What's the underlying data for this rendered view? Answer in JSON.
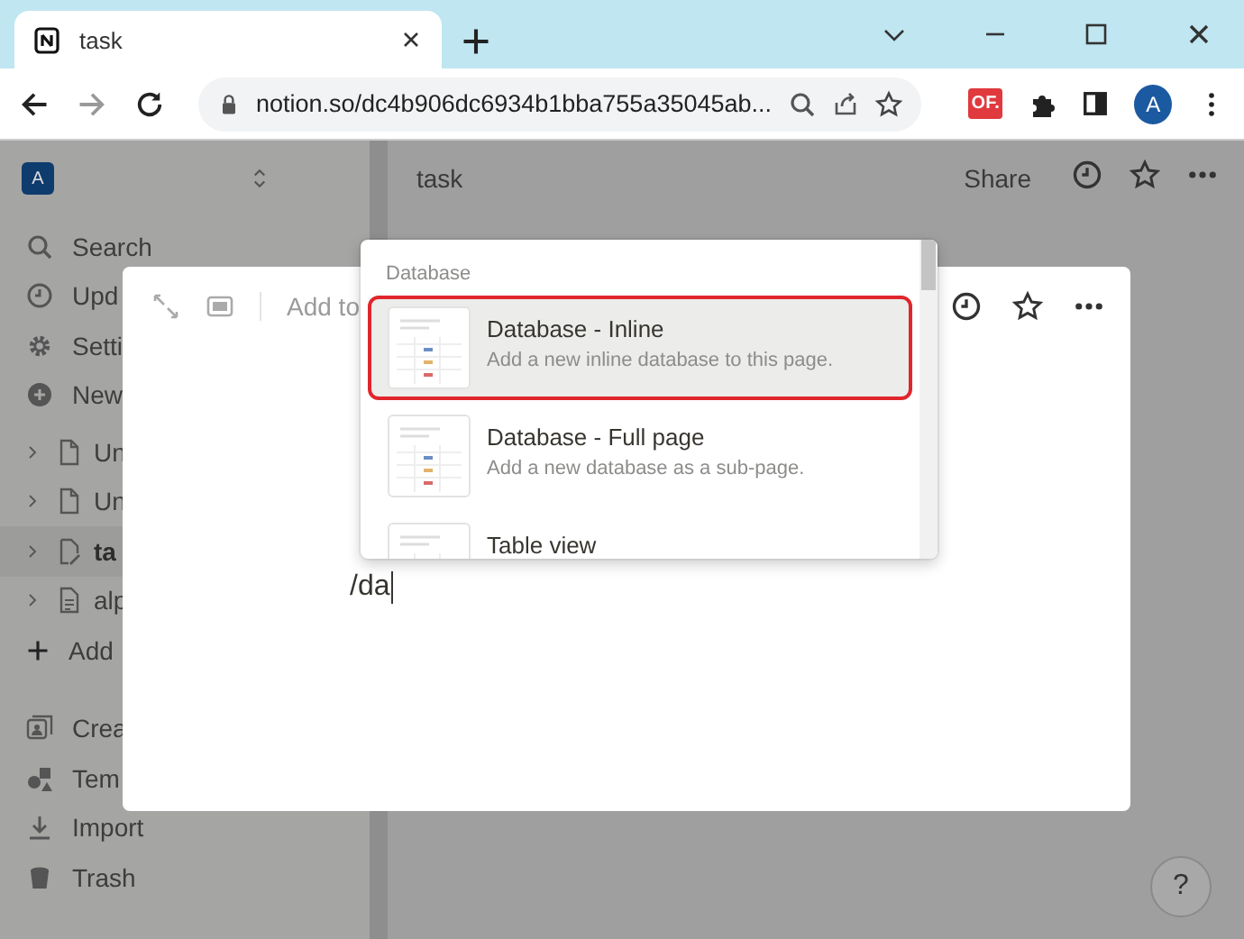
{
  "browser": {
    "tab": {
      "title": "task"
    },
    "url": "notion.so/dc4b906dc6934b1bba755a35045ab...",
    "extension_badge": "OF.",
    "profile_initial": "A"
  },
  "sidebar": {
    "workspace_initial": "A",
    "actions": [
      {
        "kind": "search",
        "label": "Search"
      },
      {
        "kind": "updates",
        "label": "Upd"
      },
      {
        "kind": "settings",
        "label": "Setti"
      },
      {
        "kind": "new",
        "label": "New"
      }
    ],
    "pages": [
      {
        "kind": "page",
        "label": "Un",
        "selected": false
      },
      {
        "kind": "page",
        "label": "Un",
        "selected": false
      },
      {
        "kind": "edit",
        "label": "ta",
        "selected": true
      },
      {
        "kind": "doc",
        "label": "alp",
        "selected": false
      }
    ],
    "add_page": "Add",
    "footer": [
      {
        "kind": "create",
        "label": "Crea"
      },
      {
        "kind": "templates",
        "label": "Tem"
      },
      {
        "kind": "import",
        "label": "Import"
      },
      {
        "kind": "trash",
        "label": "Trash"
      }
    ]
  },
  "topbar": {
    "title": "task",
    "share": "Share"
  },
  "modal": {
    "add_to": "Add to",
    "text": "/da"
  },
  "menu": {
    "section": "Database",
    "items": [
      {
        "title": "Database - Inline",
        "description": "Add a new inline database to this page.",
        "selected": true
      },
      {
        "title": "Database - Full page",
        "description": "Add a new database as a sub-page.",
        "selected": false
      },
      {
        "title": "Table view",
        "selected": false
      }
    ]
  },
  "help": "?"
}
